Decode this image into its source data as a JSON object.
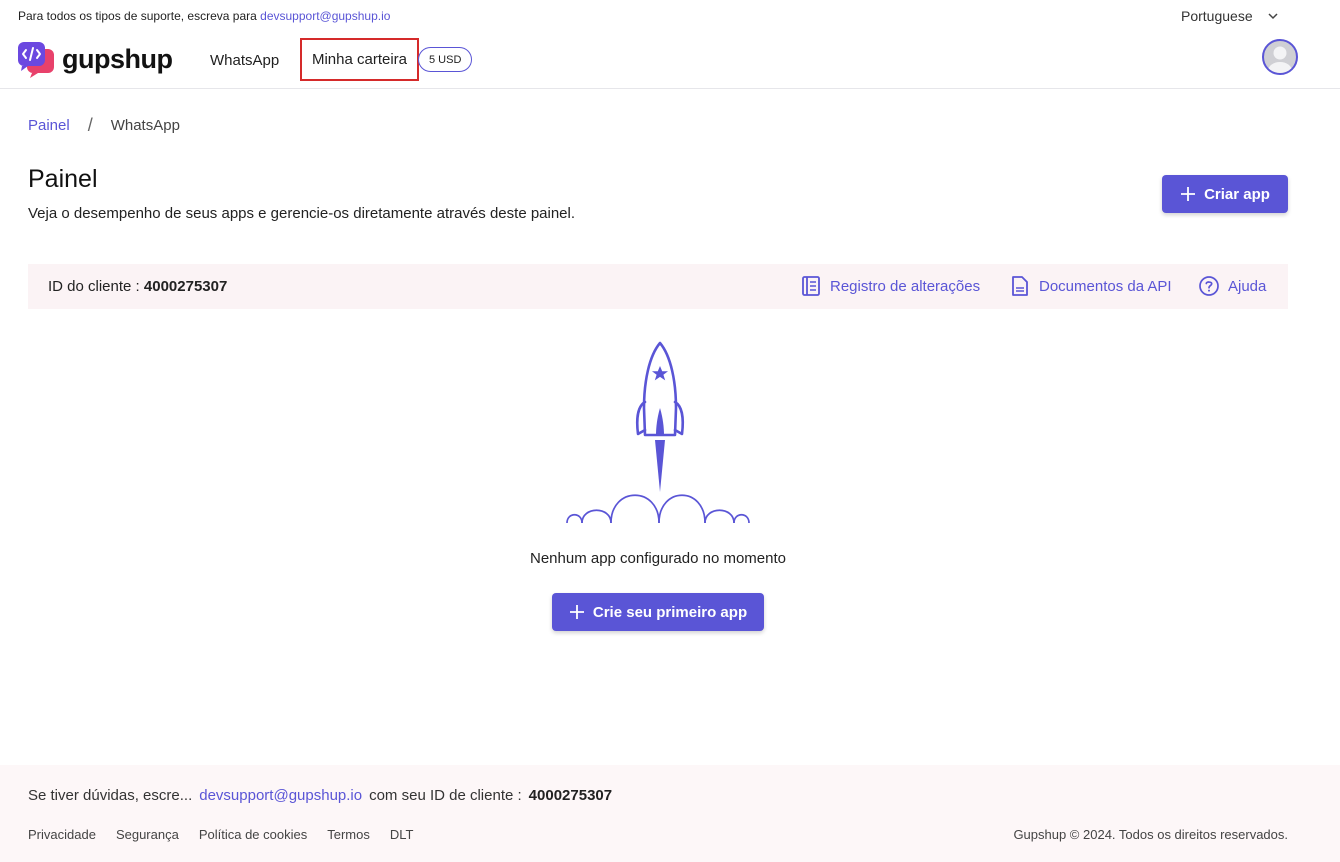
{
  "topbar": {
    "support_prefix": "Para todos os tipos de suporte, escreva para",
    "support_email": "devsupport@gupshup.io",
    "language": "Portuguese"
  },
  "brand": {
    "name": "gupshup",
    "accent": "#5a55d6"
  },
  "nav": {
    "whatsapp": "WhatsApp",
    "wallet": "Minha carteira",
    "balance": "5 USD"
  },
  "breadcrumb": {
    "home": "Painel",
    "separator": "/",
    "current": "WhatsApp"
  },
  "page": {
    "title": "Painel",
    "subtitle": "Veja o desempenho de seus apps e gerencie-os diretamente através deste painel.",
    "create_button": "Criar app"
  },
  "info_bar": {
    "client_label": "ID do cliente :",
    "client_id": "4000275307",
    "changelog": "Registro de alterações",
    "api_docs": "Documentos da API",
    "help": "Ajuda"
  },
  "empty_state": {
    "message": "Nenhum app configurado no momento",
    "button": "Crie seu primeiro app"
  },
  "footer": {
    "prefix": "Se tiver dúvidas, escre...",
    "email": "devsupport@gupshup.io",
    "middle": "com seu ID de cliente :",
    "client_id": "4000275307",
    "links": [
      "Privacidade",
      "Segurança",
      "Política de cookies",
      "Termos",
      "DLT"
    ],
    "copyright": "Gupshup © 2024. Todos os direitos reservados."
  }
}
